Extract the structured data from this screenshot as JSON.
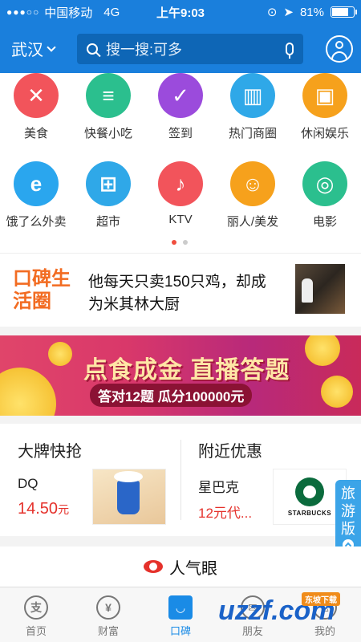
{
  "status": {
    "carrier": "中国移动",
    "network": "4G",
    "time": "上午9:03",
    "battery": "81%",
    "battery_level": 0.81
  },
  "header": {
    "city": "武汉",
    "search_placeholder": "搜一搜:可多"
  },
  "grid": {
    "items": [
      {
        "label": "美食",
        "icon": "fork-knife-icon",
        "color": "#f2545b"
      },
      {
        "label": "快餐小吃",
        "icon": "burger-icon",
        "color": "#2bbf8e"
      },
      {
        "label": "签到",
        "icon": "check-icon",
        "color": "#9b4bdc"
      },
      {
        "label": "热门商圈",
        "icon": "building-icon",
        "color": "#2fa8e8"
      },
      {
        "label": "休闲娱乐",
        "icon": "gamepad-icon",
        "color": "#f6a11c"
      },
      {
        "label": "饿了么外卖",
        "icon": "eleme-icon",
        "color": "#2aa6ee"
      },
      {
        "label": "超市",
        "icon": "basket-icon",
        "color": "#2fa8e8"
      },
      {
        "label": "KTV",
        "icon": "microphone-icon",
        "color": "#f2545b"
      },
      {
        "label": "丽人/美发",
        "icon": "woman-icon",
        "color": "#f6a11c"
      },
      {
        "label": "电影",
        "icon": "film-icon",
        "color": "#2bbf8e"
      }
    ],
    "page": 1,
    "pages": 2
  },
  "promo": {
    "logo": "口碑生活圈",
    "text": "他每天只卖150只鸡，却成为米其林大厨"
  },
  "banner": {
    "title": "点食成金 直播答题",
    "subtitle": "答对12题 瓜分100000元"
  },
  "deals": {
    "left": {
      "title": "大牌快抢",
      "name": "DQ",
      "price": "14.50",
      "unit": "元"
    },
    "right": {
      "title": "附近优惠",
      "name": "星巴克",
      "price": "12元代...",
      "image_text": "STARBUCKS"
    }
  },
  "travel": {
    "label": "旅游版"
  },
  "popular": {
    "title": "人气眼"
  },
  "tabs": [
    {
      "label": "首页",
      "icon": "alipay-icon",
      "glyph": "支"
    },
    {
      "label": "财富",
      "icon": "wealth-icon",
      "glyph": "¥"
    },
    {
      "label": "口碑",
      "icon": "koubei-icon",
      "glyph": "◡",
      "active": true
    },
    {
      "label": "朋友",
      "icon": "friends-icon",
      "glyph": "✉"
    },
    {
      "label": "我的",
      "icon": "profile-icon",
      "glyph": "♙"
    }
  ],
  "watermark": {
    "text": "uzzf.com",
    "tag": "东坡下载"
  }
}
